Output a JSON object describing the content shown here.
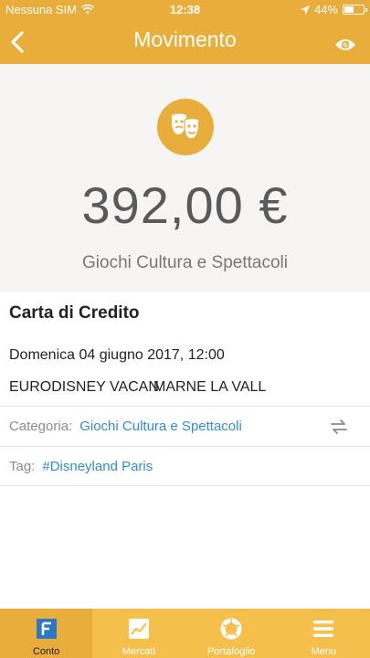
{
  "status_bar": {
    "carrier": "Nessuna SIM",
    "time": "12:38",
    "battery": "44%",
    "battery_level": 0.44
  },
  "nav": {
    "title": "Movimento",
    "back_icon": "chevron-left-icon",
    "visibility_icon": "eye-icon"
  },
  "transaction": {
    "category_icon": "theater-masks-icon",
    "amount": "392,00 €",
    "category": "Giochi Cultura e Spettacoli",
    "card_type": "Carta di Credito",
    "datetime": "Domenica 04 giugno 2017, 12:00",
    "merchant": "EURODISNEY VACAN",
    "merchant_city": "MARNE LA VALL"
  },
  "fields": {
    "category_label": "Categoria:",
    "category_value": "Giochi Cultura e Spettacoli",
    "tag_label": "Tag:",
    "tag_value": "#Disneyland Paris"
  },
  "tabs": [
    {
      "label": "Conto",
      "icon": "conto-icon",
      "active": true
    },
    {
      "label": "Mercati",
      "icon": "chart-icon",
      "active": false
    },
    {
      "label": "Portafoglio",
      "icon": "portfolio-icon",
      "active": false
    },
    {
      "label": "Menu",
      "icon": "hamburger-icon",
      "active": false
    }
  ],
  "colors": {
    "brand": "#e9ad3c",
    "tab_bar": "#f5bf4b",
    "link": "#2e8fd0",
    "hero_bg": "#f7f4f4"
  }
}
